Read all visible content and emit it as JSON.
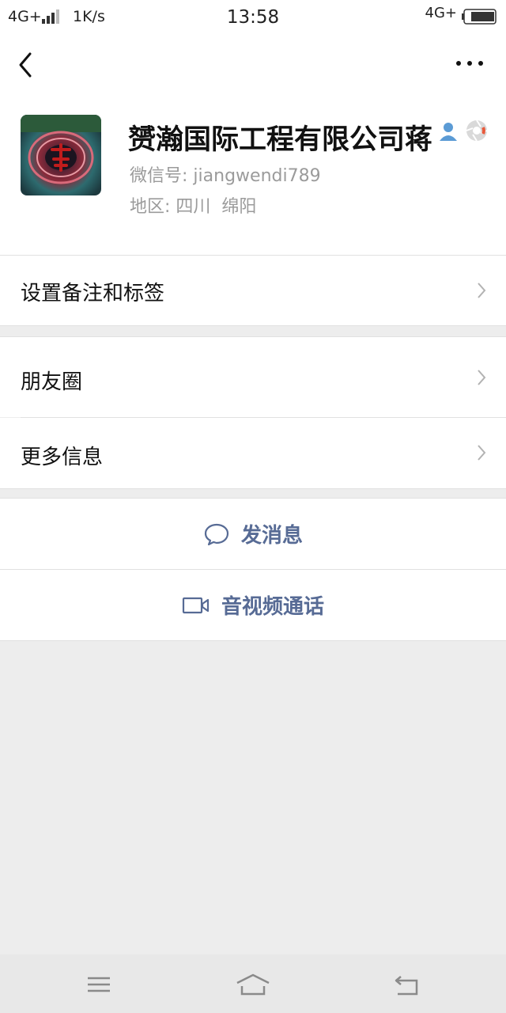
{
  "status_bar": {
    "network_left": "4G+",
    "speed": "1K/s",
    "time": "13:58",
    "network_right": "4G+"
  },
  "header": {
    "back_icon": "chevron-left-icon",
    "more_icon": "more-dots-icon"
  },
  "profile": {
    "name": "赟瀚国际工程有限公司蒋",
    "wechat_id_label": "微信号:",
    "wechat_id": "jiangwendi789",
    "region_label": "地区:",
    "region": "四川  绵阳",
    "badge_icons": [
      "person-icon",
      "shutter-icon"
    ]
  },
  "menu": {
    "remarks": "设置备注和标签",
    "moments": "朋友圈",
    "more_info": "更多信息"
  },
  "actions": {
    "message": "发消息",
    "video_call": "音视频通话"
  },
  "colors": {
    "accent": "#576b95",
    "background": "#ededed",
    "secondary_text": "#9b9b9b"
  }
}
